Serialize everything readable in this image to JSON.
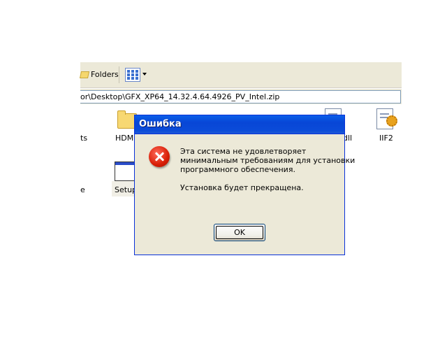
{
  "explorer": {
    "toolbar": {
      "folders_label": "Folders"
    },
    "address": "or\\Desktop\\GFX_XP64_14.32.4.64.4926_PV_Intel.zip",
    "files": [
      {
        "label": "ts",
        "icon": "partial-file-icon"
      },
      {
        "label": "HDMI",
        "icon": "folder-icon"
      },
      {
        "label": "dll",
        "icon": "document-icon"
      },
      {
        "label": "IIF2",
        "icon": "config-file-icon"
      },
      {
        "label": "e",
        "icon": "partial-file-icon"
      },
      {
        "label": "Setup",
        "icon": "setup-window-icon"
      }
    ]
  },
  "dialog": {
    "title": "Ошибка",
    "icon": "error-icon",
    "message_lines": [
      "Эта система не удовлетворяет",
      "минимальным требованиям для установки",
      "программного обеспечения."
    ],
    "message_footer": "Установка будет прекращена.",
    "ok_label": "OK",
    "colors": {
      "titlebar": "#0a4bd9",
      "body": "#ece9d8",
      "error": "#d81e06"
    }
  }
}
